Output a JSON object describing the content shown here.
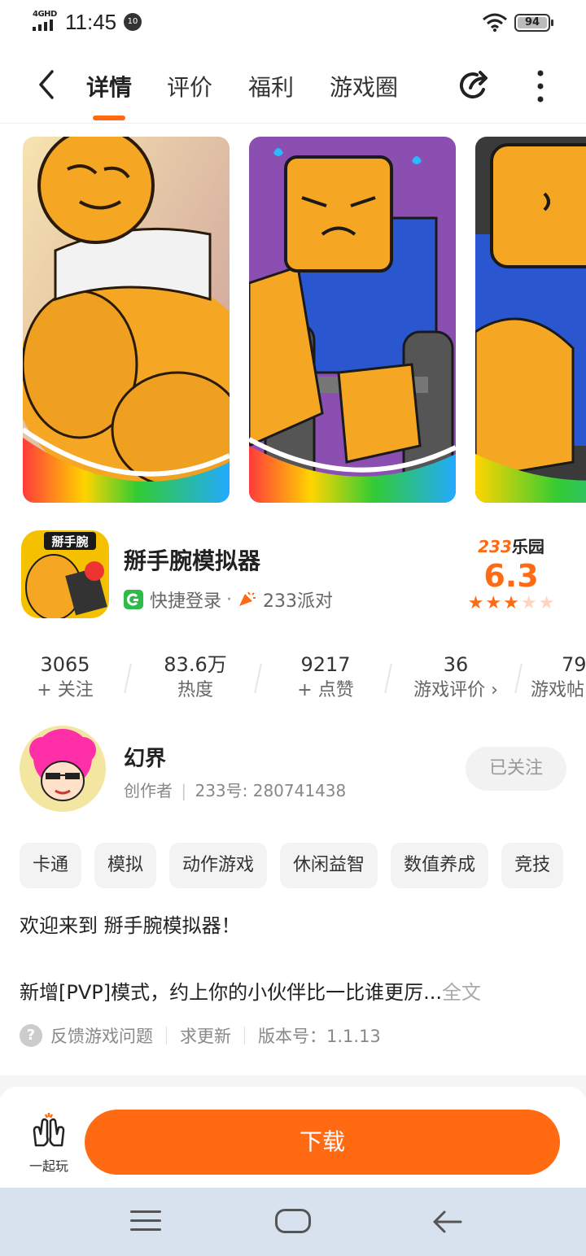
{
  "status_bar": {
    "network": "4GHD",
    "time": "11:45",
    "notification_badge": "10",
    "battery": "94"
  },
  "nav": {
    "tabs": [
      {
        "label": "详情",
        "active": true
      },
      {
        "label": "评价",
        "active": false
      },
      {
        "label": "福利",
        "active": false
      },
      {
        "label": "游戏圈",
        "active": false
      }
    ],
    "icons": [
      "back-arrow-icon",
      "share-icon",
      "more-vertical-icon"
    ]
  },
  "app": {
    "name": "掰手腕模拟器",
    "icon_text": "掰手腕",
    "login_label": "快捷登录",
    "dot": "·",
    "party_label": "233派对",
    "rating_brand_num": "233",
    "rating_brand_text": "乐园",
    "rating_score": "6.3",
    "stars": [
      1,
      1,
      1,
      0,
      0
    ]
  },
  "stats": [
    {
      "value": "3065",
      "label": "+ 关注"
    },
    {
      "value": "83.6万",
      "label": "热度"
    },
    {
      "value": "9217",
      "label": "+ 点赞"
    },
    {
      "value": "36",
      "label": "游戏评价 ›"
    },
    {
      "value": "79",
      "label": "游戏帖"
    }
  ],
  "creator": {
    "name": "幻界",
    "role": "创作者",
    "id_text": "233号: 280741438",
    "follow_label": "已关注"
  },
  "tags": [
    "卡通",
    "模拟",
    "动作游戏",
    "休闲益智",
    "数值养成",
    "竞技"
  ],
  "description": {
    "line1": "欢迎来到 掰手腕模拟器！",
    "line2": "新增[PVP]模式，约上你的小伙伴比一比谁更厉",
    "ellipsis": "...",
    "more_label": "全文"
  },
  "footer_links": {
    "feedback": "反馈游戏问题",
    "request_update": "求更新",
    "version": "版本号：1.1.13"
  },
  "bottom": {
    "play_together": "一起玩",
    "download": "下载"
  },
  "colors": {
    "accent": "#ff6a13",
    "star_empty": "#ffd4bf",
    "nav_bar": "#d8e2ef"
  }
}
